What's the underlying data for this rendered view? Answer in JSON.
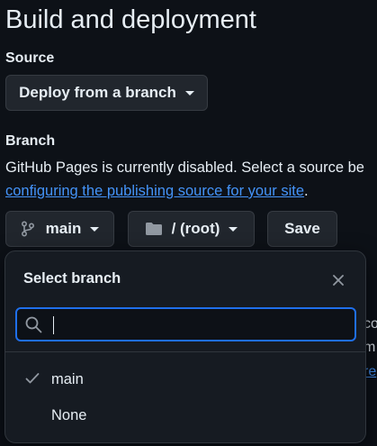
{
  "page": {
    "title": "Build and deployment"
  },
  "source": {
    "label": "Source",
    "dropdown_value": "Deploy from a branch"
  },
  "branch": {
    "label": "Branch",
    "description_text": "GitHub Pages is currently disabled. Select a source be",
    "description_link": "configuring the publishing source for your site",
    "description_suffix": ".",
    "branch_button_label": "main",
    "folder_button_label": "/ (root)",
    "save_label": "Save"
  },
  "background_peek": {
    "line1": "co",
    "line2": "m",
    "line3": "re"
  },
  "select_branch": {
    "title": "Select branch",
    "search": {
      "value": "",
      "placeholder": ""
    },
    "items": [
      {
        "label": "main",
        "selected": true
      },
      {
        "label": "None",
        "selected": false
      }
    ]
  },
  "colors": {
    "background": "#0d1117",
    "accent": "#1f6feb",
    "link": "#4493f8"
  }
}
